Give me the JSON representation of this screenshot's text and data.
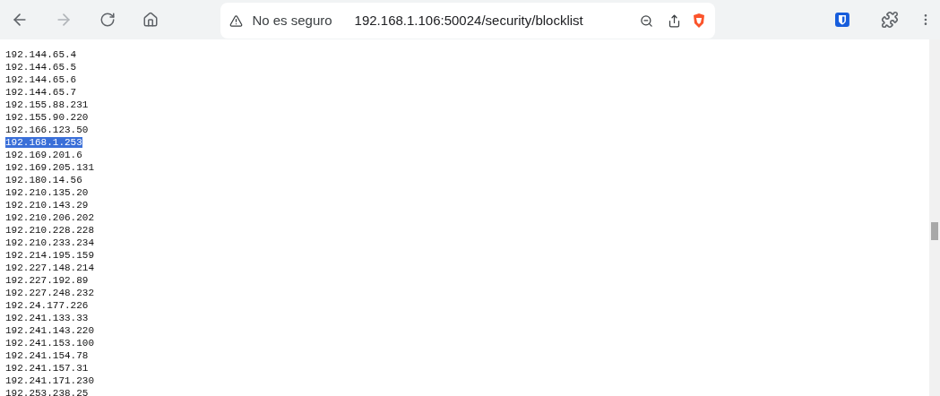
{
  "browser": {
    "back_disabled": false,
    "forward_disabled": true,
    "security_label": "No es seguro",
    "url": "192.168.1.106:50024/security/blocklist"
  },
  "lines": [
    {
      "text": "192.144.65.4",
      "selected": false
    },
    {
      "text": "192.144.65.5",
      "selected": false
    },
    {
      "text": "192.144.65.6",
      "selected": false
    },
    {
      "text": "192.144.65.7",
      "selected": false
    },
    {
      "text": "192.155.88.231",
      "selected": false
    },
    {
      "text": "192.155.90.220",
      "selected": false
    },
    {
      "text": "192.166.123.50",
      "selected": false
    },
    {
      "text": "192.168.1.253",
      "selected": true
    },
    {
      "text": "192.169.201.6",
      "selected": false
    },
    {
      "text": "192.169.205.131",
      "selected": false
    },
    {
      "text": "192.180.14.56",
      "selected": false
    },
    {
      "text": "192.210.135.20",
      "selected": false
    },
    {
      "text": "192.210.143.29",
      "selected": false
    },
    {
      "text": "192.210.206.202",
      "selected": false
    },
    {
      "text": "192.210.228.228",
      "selected": false
    },
    {
      "text": "192.210.233.234",
      "selected": false
    },
    {
      "text": "192.214.195.159",
      "selected": false
    },
    {
      "text": "192.227.148.214",
      "selected": false
    },
    {
      "text": "192.227.192.89",
      "selected": false
    },
    {
      "text": "192.227.248.232",
      "selected": false
    },
    {
      "text": "192.24.177.226",
      "selected": false
    },
    {
      "text": "192.241.133.33",
      "selected": false
    },
    {
      "text": "192.241.143.220",
      "selected": false
    },
    {
      "text": "192.241.153.100",
      "selected": false
    },
    {
      "text": "192.241.154.78",
      "selected": false
    },
    {
      "text": "192.241.157.31",
      "selected": false
    },
    {
      "text": "192.241.171.230",
      "selected": false
    },
    {
      "text": "192.253.238.25",
      "selected": false
    }
  ]
}
